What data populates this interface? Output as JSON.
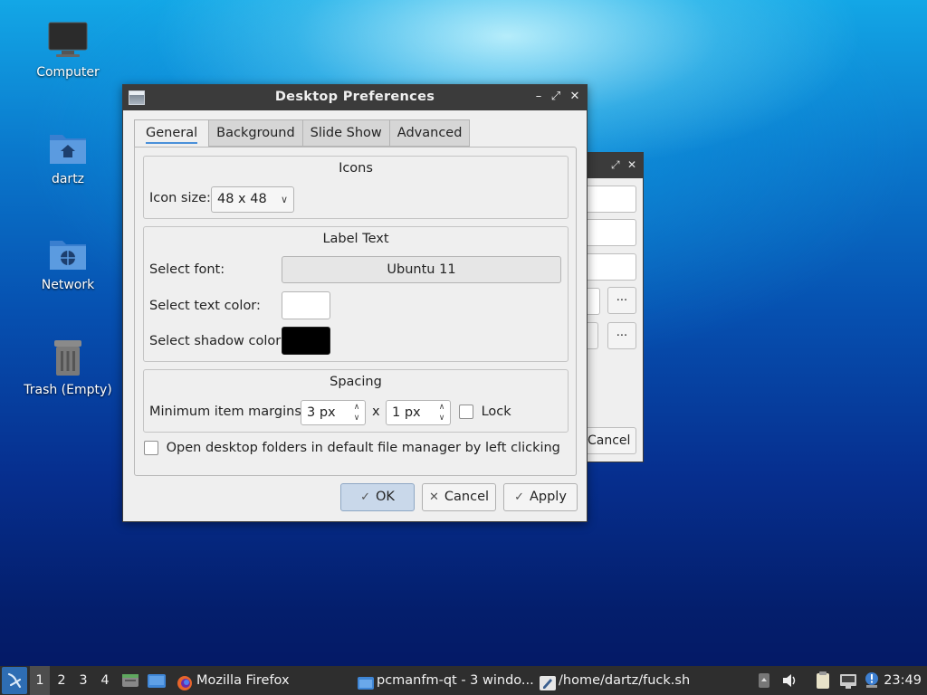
{
  "desktop": {
    "icons": [
      {
        "label": "Computer",
        "icon": "computer-icon"
      },
      {
        "label": "dartz",
        "icon": "home-folder-icon"
      },
      {
        "label": "Network",
        "icon": "network-folder-icon"
      },
      {
        "label": "Trash (Empty)",
        "icon": "trash-icon"
      }
    ]
  },
  "background_window": {
    "cancel_label": "Cancel",
    "browse_label": "..."
  },
  "dialog": {
    "title": "Desktop Preferences",
    "tabs": [
      {
        "label": "General",
        "active": true
      },
      {
        "label": "Background",
        "active": false
      },
      {
        "label": "Slide Show",
        "active": false
      },
      {
        "label": "Advanced",
        "active": false
      }
    ],
    "icons_group": {
      "title": "Icons",
      "icon_size_label": "Icon size:",
      "icon_size_value": "48 x 48"
    },
    "label_text_group": {
      "title": "Label Text",
      "font_label": "Select font:",
      "font_value": "Ubuntu 11",
      "text_color_label": "Select text color:",
      "text_color": "#ffffff",
      "shadow_color_label": "Select shadow color:",
      "shadow_color": "#000000"
    },
    "spacing_group": {
      "title": "Spacing",
      "margins_label": "Minimum item margins:",
      "margin_x": "3 px",
      "separator": "x",
      "margin_y": "1 px",
      "lock_label": "Lock",
      "lock_checked": false
    },
    "open_folders_label": "Open desktop folders in default file manager by left clicking",
    "open_folders_checked": false,
    "buttons": {
      "ok": "OK",
      "cancel": "Cancel",
      "apply": "Apply"
    }
  },
  "taskbar": {
    "workspaces": [
      "1",
      "2",
      "3",
      "4"
    ],
    "active_workspace": "1",
    "tasks": [
      {
        "label": "Mozilla Firefox",
        "icon": "firefox-icon"
      },
      {
        "label": "pcmanfm-qt - 3 windo...",
        "icon": "folder-icon"
      },
      {
        "label": "/home/dartz/fuck.sh",
        "icon": "text-editor-icon"
      }
    ],
    "clock": "23:49"
  },
  "colors": {
    "titlebar": "#3b3b3b",
    "dialog_bg": "#efefef",
    "taskbar": "#2e2e2e",
    "accent": "#4a90d9"
  }
}
